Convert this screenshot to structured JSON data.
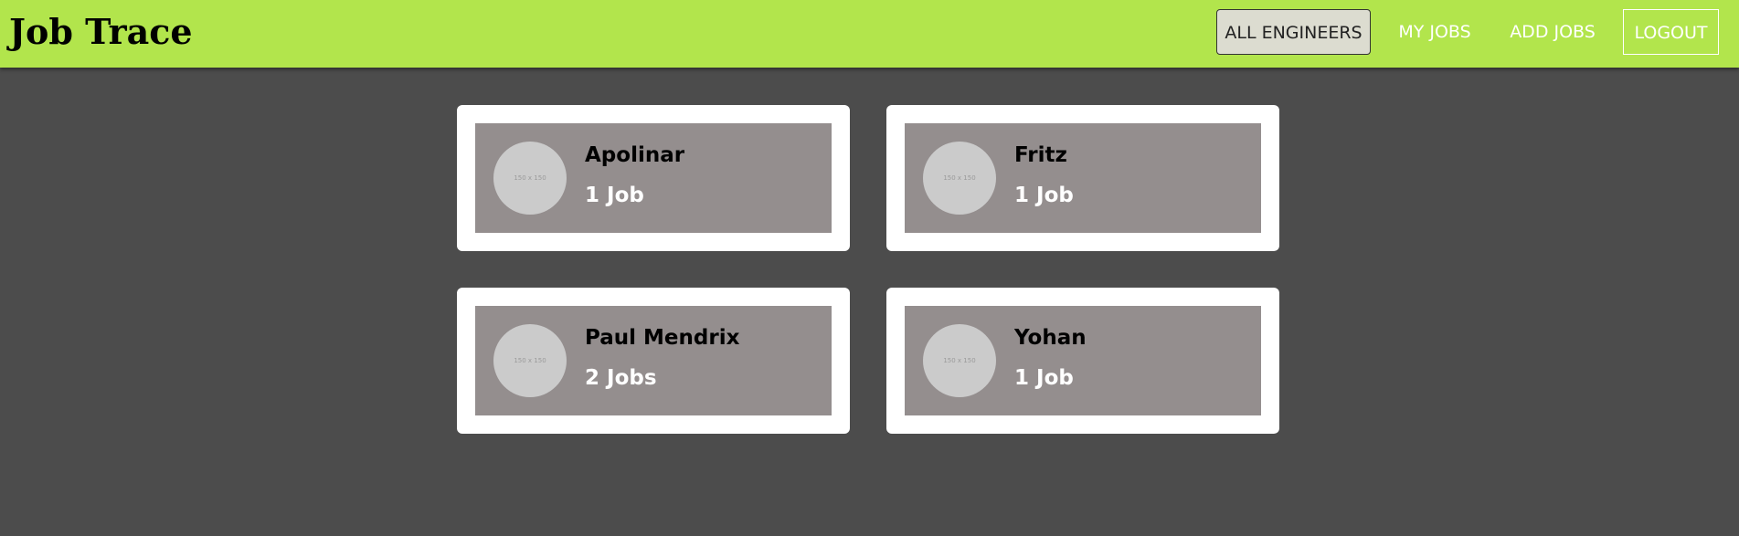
{
  "header": {
    "title": "Job Trace"
  },
  "nav": {
    "items": [
      {
        "label": "ALL ENGINEERS",
        "active": true
      },
      {
        "label": "MY JOBS",
        "active": false
      },
      {
        "label": "ADD JOBS",
        "active": false
      },
      {
        "label": "LOGOUT",
        "active": false
      }
    ]
  },
  "engineers": [
    {
      "name": "Apolinar",
      "jobs": "1 Job",
      "avatar_text": "150 x 150"
    },
    {
      "name": "Fritz",
      "jobs": "1 Job",
      "avatar_text": "150 x 150"
    },
    {
      "name": "Paul Mendrix",
      "jobs": "2 Jobs",
      "avatar_text": "150 x 150"
    },
    {
      "name": "Yohan",
      "jobs": "1 Job",
      "avatar_text": "150 x 150"
    }
  ],
  "colors": {
    "header_bg": "#b2e54c",
    "page_bg": "#4c4c4c",
    "card_bg": "#ffffff",
    "card_inner_bg": "#948e8e",
    "avatar_bg": "#cbcbcb",
    "active_nav_bg": "#dcdcd0"
  }
}
